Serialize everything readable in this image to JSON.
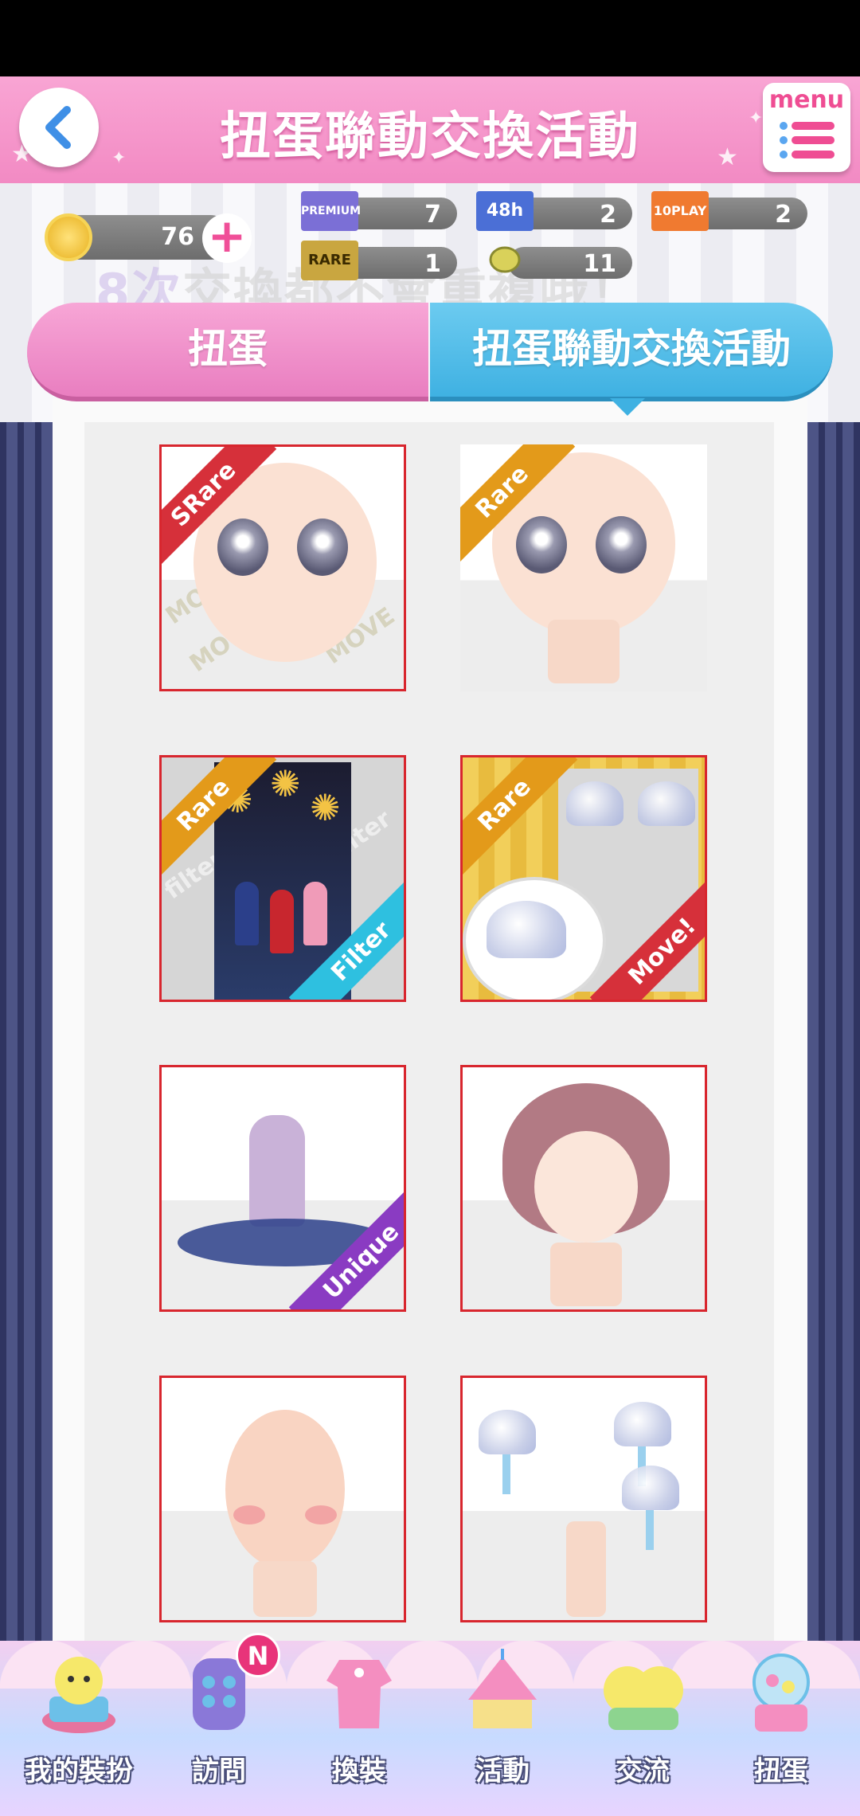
{
  "header": {
    "title": "扭蛋聯動交換活動",
    "menu_label": "menu"
  },
  "currency": {
    "coins": "76",
    "tickets": [
      {
        "name": "PREMIUM",
        "count": "7",
        "color": "#7b6fd6"
      },
      {
        "name": "48h",
        "count": "2",
        "color": "#4b6fd6"
      },
      {
        "name": "10PLAY",
        "count": "2",
        "color": "#f07a30"
      },
      {
        "name": "RARE",
        "count": "1",
        "color": "#c9a640"
      },
      {
        "name": "lemon",
        "count": "11",
        "color": "#d9d15a"
      }
    ]
  },
  "overlay_text": {
    "num": "8次",
    "rest": "交換都不會重複哦！"
  },
  "tabs": [
    {
      "label": "扭蛋",
      "active": false
    },
    {
      "label": "扭蛋聯動交換活動",
      "active": true
    }
  ],
  "items": [
    {
      "ribbon": "SRare",
      "extra": "",
      "kind": "face-move",
      "selected": true
    },
    {
      "ribbon": "Rare",
      "extra": "",
      "kind": "face",
      "selected": false
    },
    {
      "ribbon": "Rare",
      "extra": "Filter",
      "kind": "filter",
      "selected": true
    },
    {
      "ribbon": "Rare",
      "extra": "Move!",
      "kind": "move",
      "selected": true
    },
    {
      "ribbon": "",
      "extra": "Unique",
      "kind": "kimono",
      "selected": true
    },
    {
      "ribbon": "",
      "extra": "",
      "kind": "hair",
      "selected": true
    },
    {
      "ribbon": "",
      "extra": "",
      "kind": "blush",
      "selected": true
    },
    {
      "ribbon": "",
      "extra": "",
      "kind": "chimes",
      "selected": true
    }
  ],
  "watermarks": {
    "move": "MOVE",
    "filter": "filter"
  },
  "bottom_nav": [
    {
      "label": "我的裝扮",
      "icon": "my-outfit-icon"
    },
    {
      "label": "訪問",
      "icon": "visit-icon",
      "badge": "N"
    },
    {
      "label": "換裝",
      "icon": "dress-up-icon"
    },
    {
      "label": "活動",
      "icon": "event-tent-icon"
    },
    {
      "label": "交流",
      "icon": "friends-icon"
    },
    {
      "label": "扭蛋",
      "icon": "gacha-machine-icon"
    }
  ],
  "colors": {
    "pink": "#f28ac3",
    "blue": "#3fb1e2",
    "selected_border": "#d8262e"
  }
}
